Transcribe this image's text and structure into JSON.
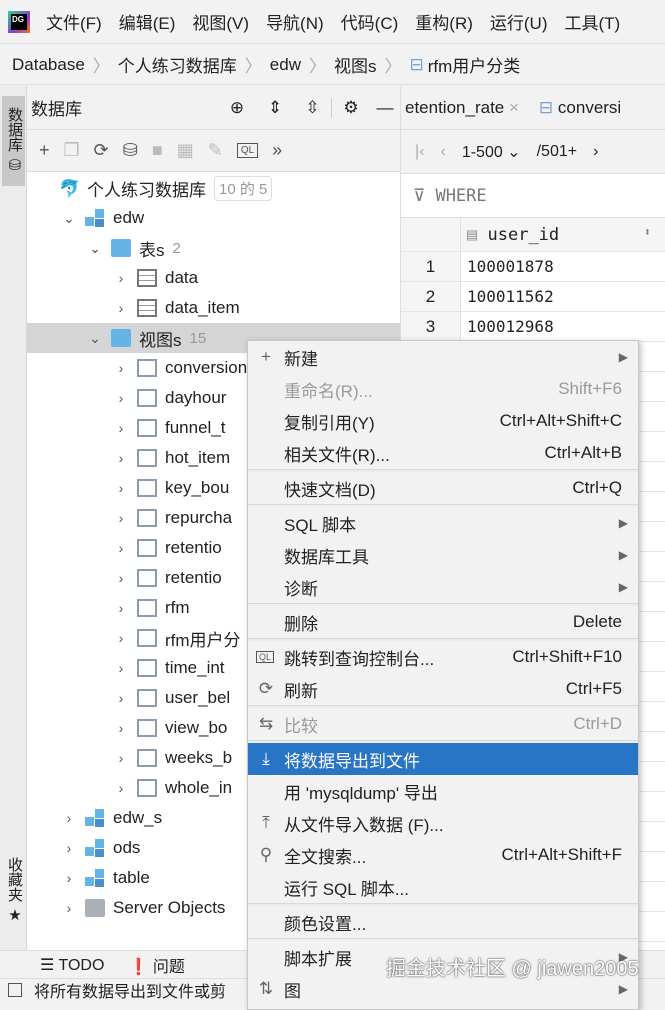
{
  "menubar": {
    "items": [
      "文件(F)",
      "编辑(E)",
      "视图(V)",
      "导航(N)",
      "代码(C)",
      "重构(R)",
      "运行(U)",
      "工具(T)"
    ]
  },
  "breadcrumb": [
    "Database",
    "个人练习数据库",
    "edw",
    "视图s",
    "rfm用户分类"
  ],
  "leftstrip": {
    "top_tab": "数据库",
    "bottom_tab": "收藏夹"
  },
  "dbpanel": {
    "title": "数据库",
    "more": "»"
  },
  "tree": [
    {
      "label": "个人练习数据库",
      "badge": "10 的 5",
      "level": 0,
      "icon": "mysql-icon",
      "chev": ""
    },
    {
      "label": "edw",
      "level": 1,
      "icon": "schema-icon",
      "chev": "⌄"
    },
    {
      "label": "表s",
      "count": "2",
      "level": 2,
      "icon": "folder-icon",
      "chev": "⌄"
    },
    {
      "label": "data",
      "level": 3,
      "icon": "table-icon",
      "chev": "›"
    },
    {
      "label": "data_item",
      "level": 3,
      "icon": "table-icon",
      "chev": "›"
    },
    {
      "label": "视图s",
      "count": "15",
      "level": 2,
      "icon": "folder-icon",
      "chev": "⌄",
      "selected": true
    },
    {
      "label": "conversion",
      "level": 3,
      "icon": "view-icon",
      "chev": "›"
    },
    {
      "label": "dayhour",
      "level": 3,
      "icon": "view-icon",
      "chev": "›"
    },
    {
      "label": "funnel_t",
      "level": 3,
      "icon": "view-icon",
      "chev": "›"
    },
    {
      "label": "hot_item",
      "level": 3,
      "icon": "view-icon",
      "chev": "›"
    },
    {
      "label": "key_bou",
      "level": 3,
      "icon": "view-icon",
      "chev": "›"
    },
    {
      "label": "repurcha",
      "level": 3,
      "icon": "view-icon",
      "chev": "›"
    },
    {
      "label": "retentio",
      "level": 3,
      "icon": "view-icon",
      "chev": "›"
    },
    {
      "label": "retentio",
      "level": 3,
      "icon": "view-icon",
      "chev": "›"
    },
    {
      "label": "rfm",
      "level": 3,
      "icon": "view-icon",
      "chev": "›"
    },
    {
      "label": "rfm用户分",
      "level": 3,
      "icon": "view-icon",
      "chev": "›"
    },
    {
      "label": "time_int",
      "level": 3,
      "icon": "view-icon",
      "chev": "›"
    },
    {
      "label": "user_bel",
      "level": 3,
      "icon": "view-icon",
      "chev": "›"
    },
    {
      "label": "view_bo",
      "level": 3,
      "icon": "view-icon",
      "chev": "›"
    },
    {
      "label": "weeks_b",
      "level": 3,
      "icon": "view-icon",
      "chev": "›"
    },
    {
      "label": "whole_in",
      "level": 3,
      "icon": "view-icon",
      "chev": "›"
    },
    {
      "label": "edw_s",
      "level": 1,
      "icon": "schema-icon",
      "chev": "›"
    },
    {
      "label": "ods",
      "level": 1,
      "icon": "schema-icon",
      "chev": "›"
    },
    {
      "label": "table",
      "level": 1,
      "icon": "schema-icon",
      "chev": "›"
    },
    {
      "label": "Server Objects",
      "level": 1,
      "icon": "server-folder-icon",
      "chev": "›"
    }
  ],
  "editor": {
    "tabs": [
      "etention_rate",
      "conversi"
    ],
    "pager": {
      "range": "1-500",
      "total": "/501+"
    },
    "where": "WHERE",
    "column": "user_id",
    "rows": [
      {
        "n": "1",
        "v": "100001878"
      },
      {
        "n": "2",
        "v": "100011562"
      },
      {
        "n": "3",
        "v": "100012968"
      }
    ]
  },
  "context_menu": [
    {
      "label": "新建",
      "arrow": true,
      "icon": "+"
    },
    {
      "label": "重命名(R)...",
      "shortcut": "Shift+F6",
      "disabled": true
    },
    {
      "label": "复制引用(Y)",
      "shortcut": "Ctrl+Alt+Shift+C"
    },
    {
      "label": "相关文件(R)...",
      "shortcut": "Ctrl+Alt+B"
    },
    {
      "sep": true
    },
    {
      "label": "快速文档(D)",
      "shortcut": "Ctrl+Q"
    },
    {
      "sep": true
    },
    {
      "label": "SQL 脚本",
      "arrow": true
    },
    {
      "label": "数据库工具",
      "arrow": true
    },
    {
      "label": "诊断",
      "arrow": true
    },
    {
      "sep": true
    },
    {
      "label": "删除",
      "shortcut": "Delete"
    },
    {
      "sep": true
    },
    {
      "label": "跳转到查询控制台...",
      "shortcut": "Ctrl+Shift+F10",
      "icon": "QL"
    },
    {
      "label": "刷新",
      "shortcut": "Ctrl+F5",
      "icon": "⟳"
    },
    {
      "sep": true
    },
    {
      "label": "比较",
      "shortcut": "Ctrl+D",
      "disabled": true,
      "icon": "⇆"
    },
    {
      "sep": true
    },
    {
      "label": "将数据导出到文件",
      "highlight": true,
      "icon": "⤓"
    },
    {
      "label": "用 'mysqldump' 导出"
    },
    {
      "label": "从文件导入数据 (F)...",
      "icon": "⤒"
    },
    {
      "label": "全文搜索...",
      "shortcut": "Ctrl+Alt+Shift+F",
      "icon": "⚲"
    },
    {
      "label": "运行 SQL 脚本..."
    },
    {
      "sep": true
    },
    {
      "label": "颜色设置..."
    },
    {
      "sep": true
    },
    {
      "label": "脚本扩展",
      "arrow": true
    },
    {
      "label": "图",
      "arrow": true,
      "icon": "⇅"
    }
  ],
  "statusbar": {
    "todo": "TODO",
    "problems": "问题"
  },
  "bottom": {
    "message": "将所有数据导出到文件或剪"
  },
  "watermark": "掘金技术社区 @ jiawen2005",
  "colors": {
    "highlight": "#2874c5",
    "folder": "#64b5e6"
  }
}
